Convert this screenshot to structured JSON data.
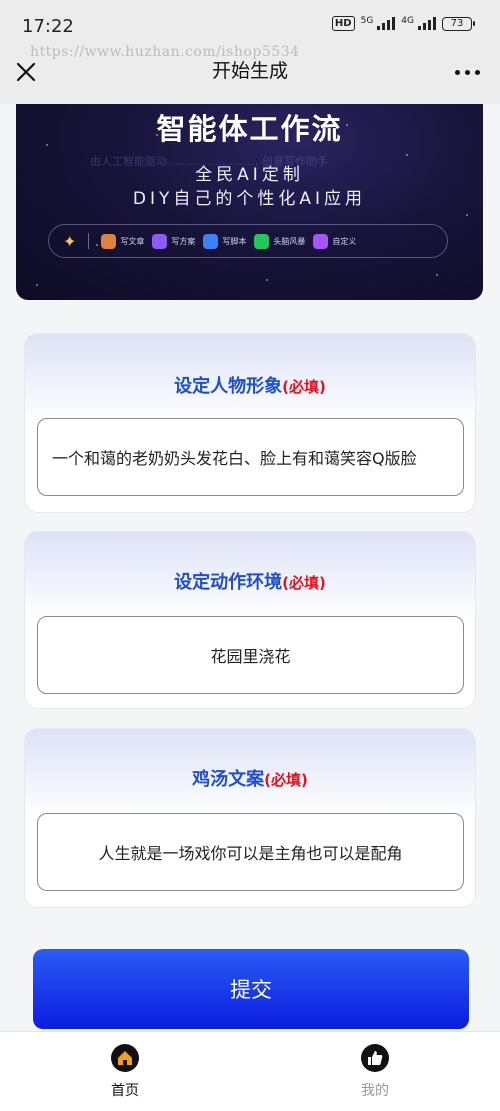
{
  "status_bar": {
    "time": "17:22",
    "hd": "HD",
    "net1": "5G",
    "net2": "4G",
    "battery": "73"
  },
  "nav": {
    "title": "开始生成",
    "watermark": "https://www.huzhan.com/ishop5534"
  },
  "banner": {
    "title": "智能体工作流",
    "faint_text": "由人工智能驱动 …………………… 创意写作助手",
    "line1": "全民AI定制",
    "line2": "DIY自己的个性化AI应用",
    "items": [
      {
        "label": "写文章",
        "color": "#e0833a"
      },
      {
        "label": "写方案",
        "color": "#8b5cf6"
      },
      {
        "label": "写脚本",
        "color": "#3b82f6"
      },
      {
        "label": "头脑风暴",
        "color": "#22c55e"
      },
      {
        "label": "自定义",
        "color": "#a855f7"
      }
    ]
  },
  "form": {
    "required_tag": "(必填)",
    "character": {
      "label": "设定人物形象",
      "value": "一个和蔼的老奶奶头发花白、脸上有和蔼笑容Q版脸"
    },
    "scene": {
      "label": "设定动作环境",
      "value": "花园里浇花"
    },
    "quote": {
      "label": "鸡汤文案",
      "value": "人生就是一场戏你可以是主角也可以是配角"
    },
    "submit_label": "提交"
  },
  "tabbar": {
    "home_label": "首页",
    "mine_label": "我的"
  }
}
